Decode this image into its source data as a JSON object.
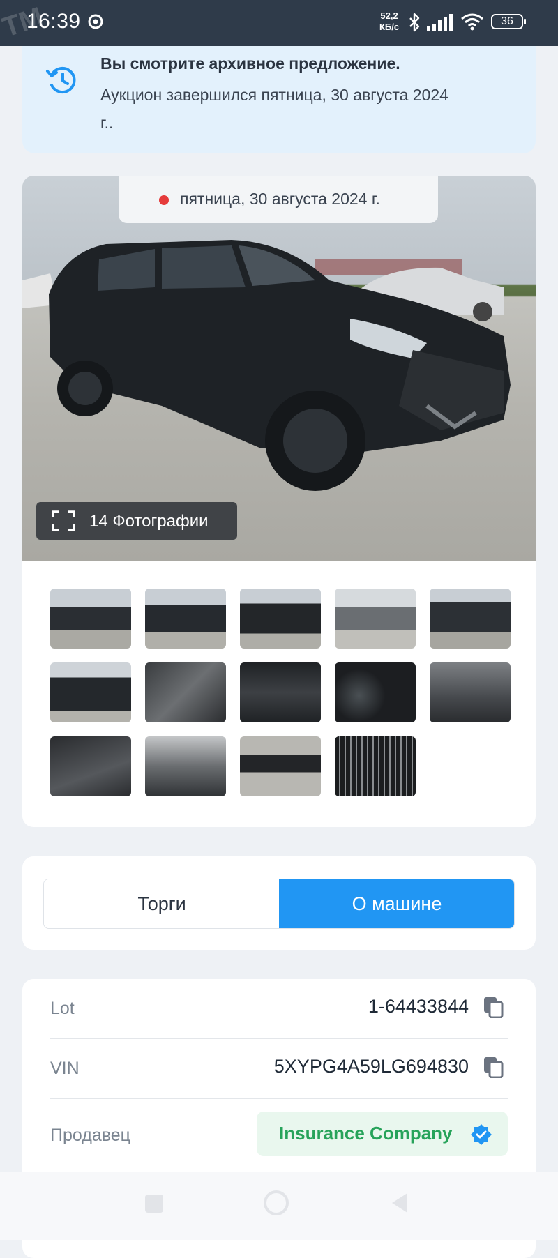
{
  "status_bar": {
    "time": "16:39",
    "speed_value": "52,2",
    "speed_unit": "КБ/с",
    "battery": "36",
    "watermark": "TM"
  },
  "notice": {
    "title": "Вы смотрите архивное предложение.",
    "body": "Аукцион завершился пятница, 30 августа 2024 г.."
  },
  "gallery": {
    "date": "пятница, 30 августа 2024 г.",
    "photos_button": "14 Фотографии",
    "thumbnail_count": 14
  },
  "tabs": {
    "items": [
      {
        "label": "Торги",
        "active": false
      },
      {
        "label": "О машине",
        "active": true
      }
    ]
  },
  "details": {
    "lot_label": "Lot",
    "lot_value": "1-64433844",
    "vin_label": "VIN",
    "vin_value": "5XYPG4A59LG694830",
    "seller_label": "Продавец",
    "seller_value": "Insurance Company"
  },
  "colors": {
    "accent": "#2196f3",
    "notice_bg": "#e3f1fc",
    "seller_green": "#27a35a",
    "live_dot": "#e53b3b"
  }
}
